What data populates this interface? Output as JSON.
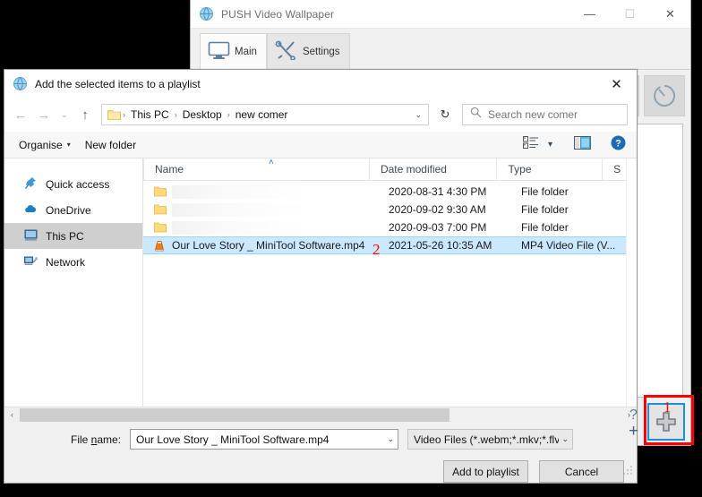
{
  "background": {
    "color": "#000000"
  },
  "push_window": {
    "title": "PUSH Video Wallpaper",
    "title_icon": "globe-icon",
    "window_buttons": [
      {
        "name": "minimize",
        "glyph": "—"
      },
      {
        "name": "maximize",
        "glyph": "☐"
      },
      {
        "name": "close",
        "glyph": "✕"
      }
    ],
    "tabs": [
      {
        "label": "Main",
        "icon": "monitor-icon",
        "active": true
      },
      {
        "label": "Settings",
        "icon": "tools-icon",
        "active": false
      }
    ],
    "tools": [
      {
        "name": "shuffle-icon"
      },
      {
        "name": "timer-icon"
      }
    ],
    "bottom_tools": [
      {
        "name": "help-icon",
        "glyph": "?"
      },
      {
        "name": "add-icon",
        "glyph": "+"
      }
    ]
  },
  "annotations": [
    {
      "label": "1",
      "color": "#ff0000",
      "target": "add-button"
    },
    {
      "label": "2",
      "color": "#ff0000",
      "target": "selected-file-row"
    }
  ],
  "dialog": {
    "title": "Add the selected items to a playlist",
    "title_icon": "globe-icon",
    "close_label": "✕",
    "nav": {
      "back": "←",
      "forward": "→",
      "recent": "⌄",
      "up": "↑",
      "refresh": "↻",
      "address_caret": "⌄",
      "breadcrumbs": [
        "This PC",
        "Desktop",
        "new comer"
      ],
      "breadcrumb_separator": "›",
      "folder_icon": "folder-icon"
    },
    "search": {
      "placeholder": "Search new comer",
      "icon": "search-icon"
    },
    "commandbar": {
      "organise_label": "Organise",
      "organise_caret": "▾",
      "new_folder_label": "New folder",
      "view_icon": "view-list-icon",
      "view_caret": "▾",
      "preview_icon": "preview-pane-icon",
      "help_icon": "help-icon"
    },
    "navpane": {
      "items": [
        {
          "label": "Quick access",
          "icon": "pin-icon",
          "selected": false
        },
        {
          "label": "OneDrive",
          "icon": "cloud-icon",
          "selected": false
        },
        {
          "label": "This PC",
          "icon": "computer-icon",
          "selected": true
        },
        {
          "label": "Network",
          "icon": "network-icon",
          "selected": false
        }
      ]
    },
    "filelist": {
      "columns": [
        "Name",
        "Date modified",
        "Type",
        "S"
      ],
      "sort_indicator": "˄",
      "rows": [
        {
          "name": "",
          "redacted": true,
          "icon": "folder-icon",
          "date": "2020-08-31 4:30 PM",
          "type": "File folder",
          "selected": false
        },
        {
          "name": "",
          "redacted": true,
          "icon": "folder-icon",
          "date": "2020-09-02 9:30 AM",
          "type": "File folder",
          "selected": false
        },
        {
          "name": "",
          "redacted": true,
          "icon": "folder-icon",
          "date": "2020-09-03 7:00 PM",
          "type": "File folder",
          "selected": false
        },
        {
          "name": "Our Love Story _ MiniTool Software.mp4",
          "redacted": false,
          "icon": "vlc-icon",
          "date": "2021-05-26 10:35 AM",
          "type": "MP4 Video File (V...",
          "selected": true
        }
      ]
    },
    "hscroll": {
      "left_glyph": "‹",
      "right_glyph": "›"
    },
    "footer": {
      "filename_label_pre": "File ",
      "filename_label_accel": "n",
      "filename_label_post": "ame:",
      "filename_value": "Our Love Story _ MiniTool Software.mp4",
      "filter_value": "Video Files (*.webm;*.mkv;*.flv;",
      "caret": "⌄",
      "primary_button": "Add to playlist",
      "secondary_button": "Cancel"
    }
  }
}
